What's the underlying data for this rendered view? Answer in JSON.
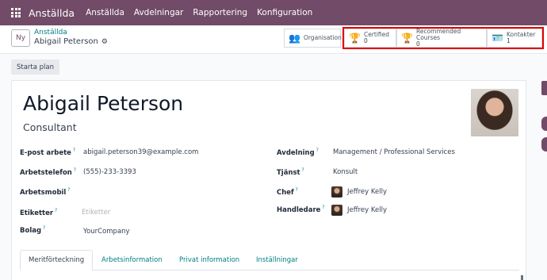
{
  "navbar": {
    "brand": "Anställda",
    "menu": [
      "Anställda",
      "Avdelningar",
      "Rapportering",
      "Konfiguration"
    ]
  },
  "control_panel": {
    "new_button": "Ny",
    "breadcrumb_parent": "Anställda",
    "breadcrumb_current": "Abigail Peterson",
    "smart_buttons": [
      {
        "label": "Organisation",
        "value": "",
        "icon": "org-chart-icon"
      },
      {
        "label": "Certified",
        "value": "0",
        "icon": "trophy-icon"
      },
      {
        "label": "Recommended Courses",
        "value": "0",
        "icon": "trophy-icon"
      },
      {
        "label": "Kontakter",
        "value": "1",
        "icon": "contact-card-icon"
      }
    ]
  },
  "statusbar": {
    "plan_button": "Starta plan"
  },
  "employee": {
    "name": "Abigail Peterson",
    "job_title": "Consultant",
    "fields_left": [
      {
        "label": "E-post arbete",
        "value": "abigail.peterson39@example.com"
      },
      {
        "label": "Arbetstelefon",
        "value": "(555)-233-3393"
      },
      {
        "label": "Arbetsmobil",
        "value": ""
      },
      {
        "label": "Etiketter",
        "value": "",
        "placeholder": "Etiketter"
      },
      {
        "label": "Bolag",
        "value": "YourCompany"
      }
    ],
    "fields_right": [
      {
        "label": "Avdelning",
        "value": "Management / Professional Services"
      },
      {
        "label": "Tjänst",
        "value": "Konsult"
      },
      {
        "label": "Chef",
        "value": "Jeffrey Kelly"
      },
      {
        "label": "Handledare",
        "value": "Jeffrey Kelly"
      }
    ]
  },
  "tabs": [
    "Meritförteckning",
    "Arbetsinformation",
    "Privat information",
    "Inställningar"
  ],
  "colors": {
    "brand": "#714b67",
    "link": "#017e84",
    "highlight": "#e00000"
  }
}
